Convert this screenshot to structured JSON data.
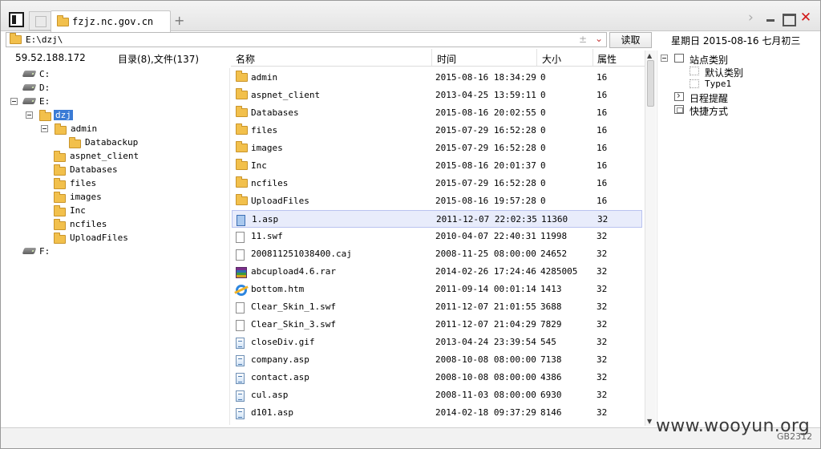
{
  "tab": {
    "title": "fzjz.nc.gov.cn"
  },
  "address": {
    "path": "E:\\dzj\\",
    "read_label": "读取"
  },
  "date_line": "星期日 2015-08-16 七月初三",
  "info": {
    "ip": "59.52.188.172",
    "summary": "目录(8),文件(137)"
  },
  "columns": {
    "name": "名称",
    "time": "时间",
    "size": "大小",
    "attr": "属性"
  },
  "tree": {
    "drives": {
      "c": "C:",
      "d": "D:",
      "e": "E:",
      "f": "F:"
    },
    "dzj": "dzj",
    "admin": "admin",
    "databackup": "Databackup",
    "folders": [
      "aspnet_client",
      "Databases",
      "files",
      "images",
      "Inc",
      "ncfiles",
      "UploadFiles"
    ]
  },
  "files": [
    {
      "name": "admin",
      "time": "2015-08-16 18:34:29",
      "size": "0",
      "attr": "16",
      "icon": "folder-icon"
    },
    {
      "name": "aspnet_client",
      "time": "2013-04-25 13:59:11",
      "size": "0",
      "attr": "16",
      "icon": "folder-icon"
    },
    {
      "name": "Databases",
      "time": "2015-08-16 20:02:55",
      "size": "0",
      "attr": "16",
      "icon": "folder-icon"
    },
    {
      "name": "files",
      "time": "2015-07-29 16:52:28",
      "size": "0",
      "attr": "16",
      "icon": "folder-icon"
    },
    {
      "name": "images",
      "time": "2015-07-29 16:52:28",
      "size": "0",
      "attr": "16",
      "icon": "folder-icon"
    },
    {
      "name": "Inc",
      "time": "2015-08-16 20:01:37",
      "size": "0",
      "attr": "16",
      "icon": "folder-icon"
    },
    {
      "name": "ncfiles",
      "time": "2015-07-29 16:52:28",
      "size": "0",
      "attr": "16",
      "icon": "folder-icon"
    },
    {
      "name": "UploadFiles",
      "time": "2015-08-16 19:57:28",
      "size": "0",
      "attr": "16",
      "icon": "folder-icon"
    },
    {
      "name": "1.asp",
      "time": "2011-12-07 22:02:35",
      "size": "11360",
      "attr": "32",
      "icon": "asp-file-icon"
    },
    {
      "name": "11.swf",
      "time": "2010-04-07 22:40:31",
      "size": "11998",
      "attr": "32",
      "icon": "blank-file-icon"
    },
    {
      "name": "200811251038400.caj",
      "time": "2008-11-25 08:00:00",
      "size": "24652",
      "attr": "32",
      "icon": "blank-file-icon"
    },
    {
      "name": "abcupload4.6.rar",
      "time": "2014-02-26 17:24:46",
      "size": "4285005",
      "attr": "32",
      "icon": "rar-archive-icon"
    },
    {
      "name": "bottom.htm",
      "time": "2011-09-14 00:01:14",
      "size": "1413",
      "attr": "32",
      "icon": "ie-html-icon"
    },
    {
      "name": "Clear_Skin_1.swf",
      "time": "2011-12-07 21:01:55",
      "size": "3688",
      "attr": "32",
      "icon": "blank-file-icon"
    },
    {
      "name": "Clear_Skin_3.swf",
      "time": "2011-12-07 21:04:29",
      "size": "7829",
      "attr": "32",
      "icon": "blank-file-icon"
    },
    {
      "name": "closeDiv.gif",
      "time": "2013-04-24 23:39:54",
      "size": "545",
      "attr": "32",
      "icon": "asp-file-icon"
    },
    {
      "name": "company.asp",
      "time": "2008-10-08 08:00:00",
      "size": "7138",
      "attr": "32",
      "icon": "asp-file-icon"
    },
    {
      "name": "contact.asp",
      "time": "2008-10-08 08:00:00",
      "size": "4386",
      "attr": "32",
      "icon": "asp-file-icon"
    },
    {
      "name": "cul.asp",
      "time": "2008-11-03 08:00:00",
      "size": "6930",
      "attr": "32",
      "icon": "asp-file-icon"
    },
    {
      "name": "d101.asp",
      "time": "2014-02-18 09:37:29",
      "size": "8146",
      "attr": "32",
      "icon": "asp-file-icon"
    }
  ],
  "selected_file": "1.asp",
  "right_panel": {
    "category": "站点类别",
    "default_category": "默认类别",
    "type1": "Type1",
    "schedule": "日程提醒",
    "shortcut": "快捷方式"
  },
  "watermark": "www.wooyun.org",
  "encoding": "GB2312",
  "colors": {
    "selection_bg": "#e8ecfb",
    "tree_selection": "#3a7bd5",
    "folder": "#f2c04c",
    "close": "#d21818"
  }
}
